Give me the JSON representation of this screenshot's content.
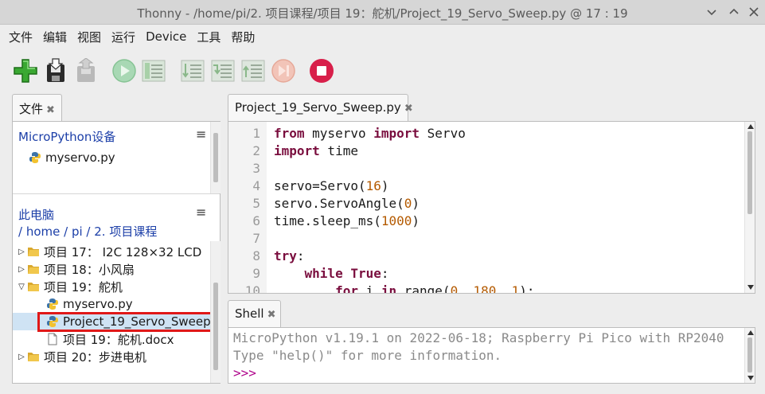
{
  "window": {
    "title": "Thonny  -  /home/pi/2. 项目课程/项目 19：舵机/Project_19_Servo_Sweep.py  @  17 : 19"
  },
  "menu": [
    "文件",
    "编辑",
    "视图",
    "运行",
    "Device",
    "工具",
    "帮助"
  ],
  "toolbar": {
    "icons": [
      "new-file-icon",
      "save-icon",
      "load-icon",
      "run-icon",
      "debug-icon",
      "step-over-icon",
      "step-into-icon",
      "step-out-icon",
      "resume-icon",
      "stop-icon"
    ]
  },
  "files_panel": {
    "tab_label": "文件",
    "micropython_header": "MicroPython设备",
    "micropython_files": [
      "myservo.py"
    ],
    "computer_header": "此电脑",
    "path": [
      "/ ",
      "home",
      " / ",
      "pi",
      " / ",
      "2. 项目课程"
    ],
    "tree": [
      {
        "label": "项目 17： I2C 128×32 LCD",
        "type": "folder",
        "expanded": false,
        "level": 0
      },
      {
        "label": "项目 18：小风扇",
        "type": "folder",
        "expanded": false,
        "level": 0
      },
      {
        "label": "项目 19：舵机",
        "type": "folder",
        "expanded": true,
        "level": 0
      },
      {
        "label": "myservo.py",
        "type": "python",
        "level": 1
      },
      {
        "label": "Project_19_Servo_Sweep.",
        "type": "python",
        "level": 1,
        "selected": true
      },
      {
        "label": "项目 19：舵机.docx",
        "type": "doc",
        "level": 1
      },
      {
        "label": "项目 20：步进电机",
        "type": "folder",
        "expanded": false,
        "level": 0
      }
    ]
  },
  "editor": {
    "tab_label": "Project_19_Servo_Sweep.py",
    "line_numbers": [
      "1",
      "2",
      "3",
      "4",
      "5",
      "6",
      "7",
      "8",
      "9",
      "10"
    ],
    "lines": [
      [
        {
          "t": "from",
          "c": "kw"
        },
        {
          "t": " myservo "
        },
        {
          "t": "import",
          "c": "kw"
        },
        {
          "t": " Servo"
        }
      ],
      [
        {
          "t": "import",
          "c": "kw"
        },
        {
          "t": " time"
        }
      ],
      [],
      [
        {
          "t": "servo=Servo("
        },
        {
          "t": "16",
          "c": "num"
        },
        {
          "t": ")"
        }
      ],
      [
        {
          "t": "servo.ServoAngle("
        },
        {
          "t": "0",
          "c": "num"
        },
        {
          "t": ")"
        }
      ],
      [
        {
          "t": "time.sleep_ms("
        },
        {
          "t": "1000",
          "c": "num"
        },
        {
          "t": ")"
        }
      ],
      [],
      [
        {
          "t": "try",
          "c": "kw"
        },
        {
          "t": ":"
        }
      ],
      [
        {
          "t": "    "
        },
        {
          "t": "while",
          "c": "kw"
        },
        {
          "t": " "
        },
        {
          "t": "True",
          "c": "kw"
        },
        {
          "t": ":"
        }
      ],
      [
        {
          "t": "        "
        },
        {
          "t": "for",
          "c": "kw"
        },
        {
          "t": " i "
        },
        {
          "t": "in",
          "c": "kw"
        },
        {
          "t": " range("
        },
        {
          "t": "0",
          "c": "num"
        },
        {
          "t": ", "
        },
        {
          "t": "180",
          "c": "num"
        },
        {
          "t": ", "
        },
        {
          "t": "1",
          "c": "num"
        },
        {
          "t": "):"
        }
      ]
    ]
  },
  "shell": {
    "tab_label": "Shell",
    "lines": [
      "MicroPython v1.19.1 on 2022-06-18; Raspberry Pi Pico with RP2040",
      "Type \"help()\" for more information."
    ],
    "prompt": ">>>"
  },
  "colors": {
    "keyword": "#7a0e3e",
    "number": "#b45a00",
    "link_blue": "#1c3fa8",
    "selection": "#cfe3f4",
    "highlight_box": "#e01818",
    "stop_red": "#d81f4a"
  }
}
